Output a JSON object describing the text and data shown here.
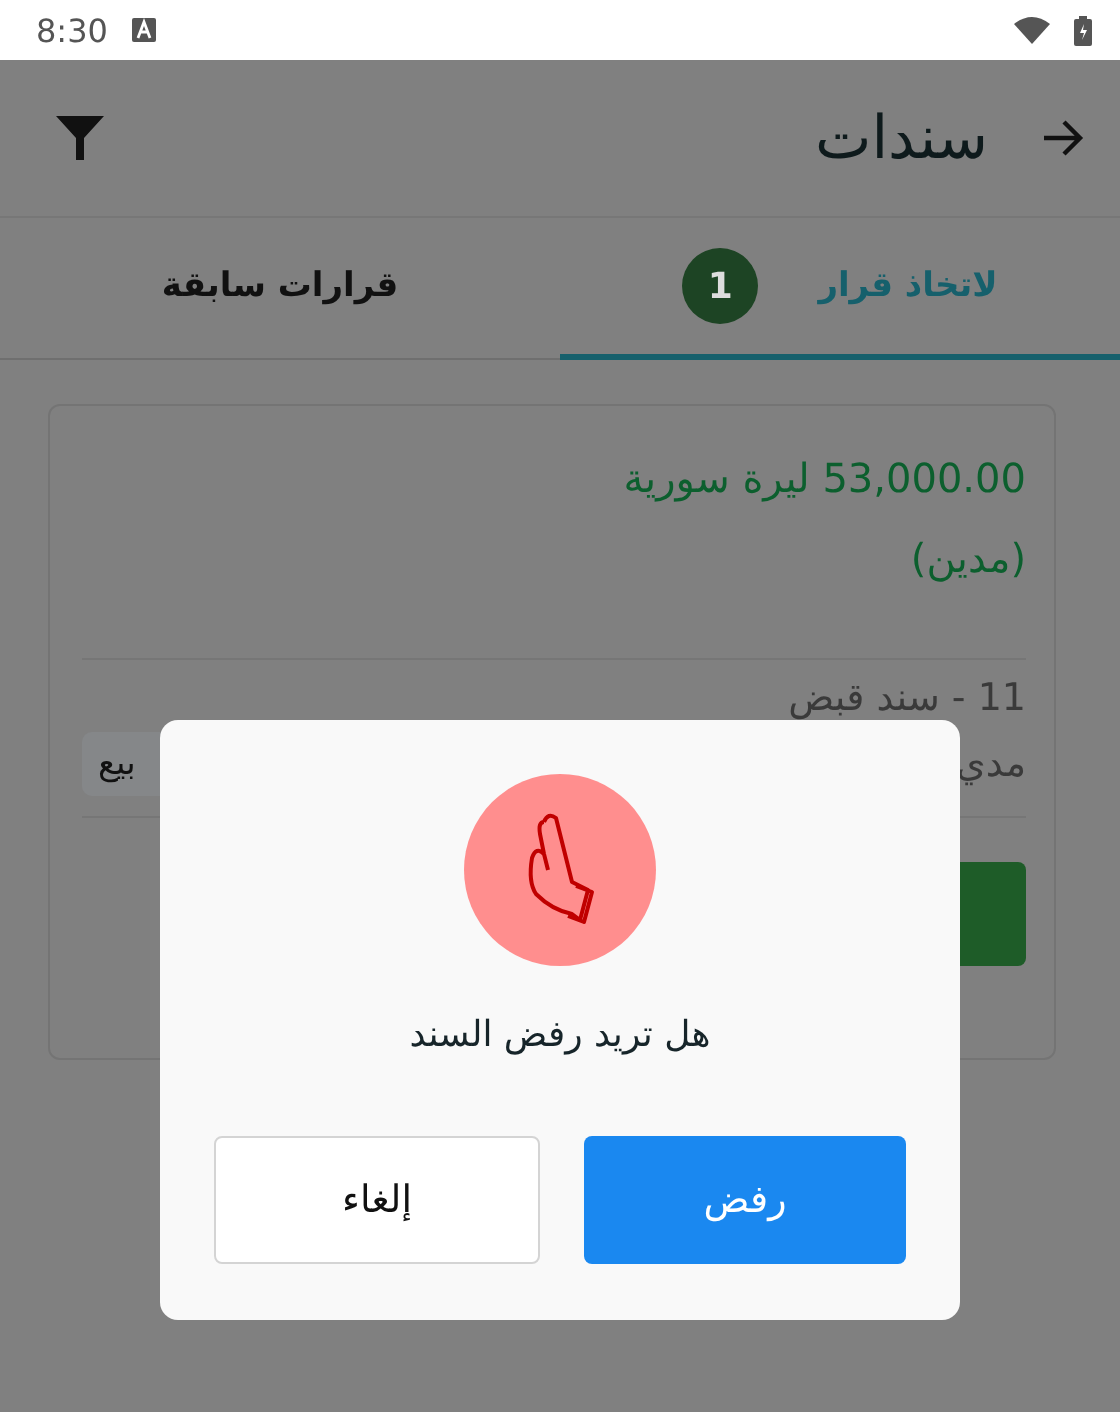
{
  "status_bar": {
    "time": "8:30"
  },
  "app_bar": {
    "title": "سندات"
  },
  "tabs": [
    {
      "label": "لاتخاذ قرار",
      "badge": "1",
      "selected": true
    },
    {
      "label": "قرارات سابقة",
      "selected": false
    }
  ],
  "voucher": {
    "amount": "53,000.00 ليرة سورية",
    "side": "(مدين)",
    "number": "11 - سند قبض",
    "detail": "مدي",
    "tag": "بيع"
  },
  "dialog": {
    "message": "هل تريد رفض السند",
    "buttons": [
      {
        "label": "رفض",
        "kind": "primary"
      },
      {
        "label": "إلغاء",
        "kind": "secondary"
      }
    ]
  }
}
